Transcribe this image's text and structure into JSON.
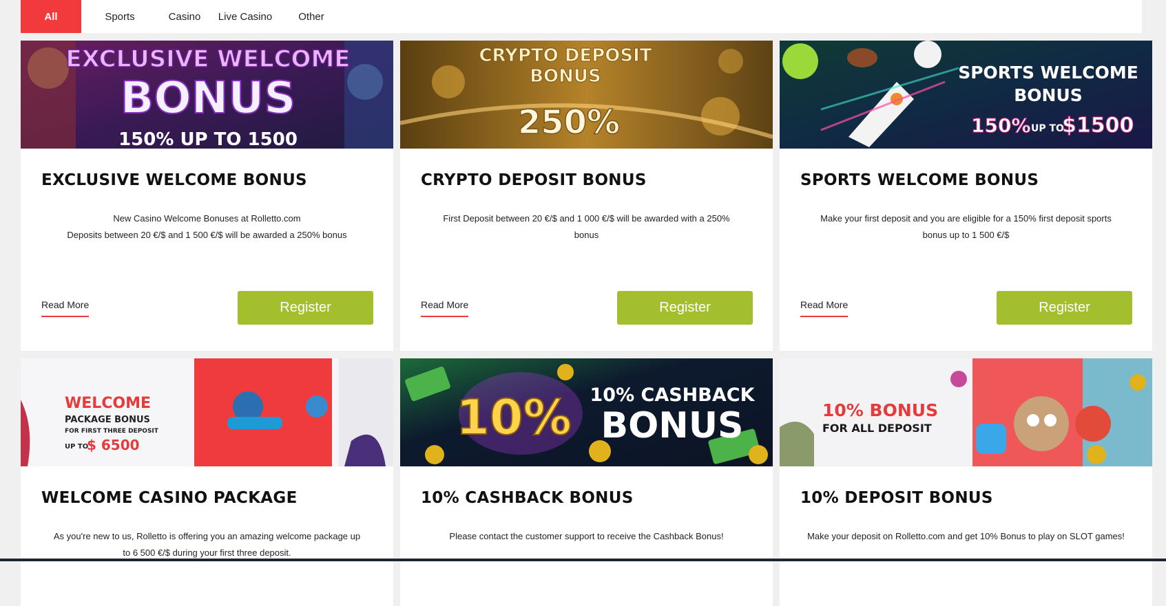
{
  "tabs": [
    {
      "label": "All",
      "active": true
    },
    {
      "label": "Sports",
      "active": false
    },
    {
      "label": "Casino",
      "active": false
    },
    {
      "label": "Live Casino",
      "active": false
    },
    {
      "label": "Other",
      "active": false
    }
  ],
  "cards": [
    {
      "banner_lines": [
        "EXCLUSIVE WELCOME",
        "BONUS",
        "150% UP TO 1500"
      ],
      "title": "EXCLUSIVE WELCOME BONUS",
      "desc": [
        "New Casino Welcome Bonuses at Rolletto.com",
        "Deposits between 20 €/$ and 1 500 €/$ will be awarded a 250% bonus"
      ],
      "read_more": "Read More",
      "register": "Register"
    },
    {
      "banner_lines": [
        "CRYPTO DEPOSIT",
        "BONUS",
        "250%"
      ],
      "title": "CRYPTO DEPOSIT BONUS",
      "desc": [
        "First Deposit between 20 €/$ and 1 000 €/$ will be awarded with a 250%",
        "bonus"
      ],
      "read_more": "Read More",
      "register": "Register"
    },
    {
      "banner_lines": [
        "SPORTS WELCOME",
        "BONUS",
        "150%",
        "UP TO",
        "$1500"
      ],
      "title": "SPORTS WELCOME BONUS",
      "desc": [
        "Make your first deposit and you are eligible for a 150% first deposit sports",
        "bonus up to 1 500 €/$"
      ],
      "read_more": "Read More",
      "register": "Register"
    },
    {
      "banner_lines": [
        "WELCOME",
        "PACKAGE BONUS",
        "FOR FIRST THREE DEPOSIT",
        "UP TO",
        "$ 6500"
      ],
      "title": "WELCOME CASINO PACKAGE",
      "desc": [
        "As you're new to us, Rolletto is offering you an amazing welcome package up",
        "to 6 500 €/$ during your first three deposit."
      ]
    },
    {
      "banner_lines": [
        "10%",
        "10% CASHBACK",
        "BONUS"
      ],
      "title": "10% CASHBACK BONUS",
      "desc": [
        "Please contact the customer support to receive the Cashback Bonus!"
      ]
    },
    {
      "banner_lines": [
        "10% BONUS",
        "FOR ALL DEPOSIT"
      ],
      "title": "10% DEPOSIT BONUS",
      "desc": [
        "Make your deposit on Rolletto.com and get 10% Bonus to play on SLOT games!"
      ]
    }
  ],
  "colors": {
    "accent_red": "#f23a3c",
    "register_green": "#a4bf2e",
    "page_bg": "#f0f0f0"
  }
}
